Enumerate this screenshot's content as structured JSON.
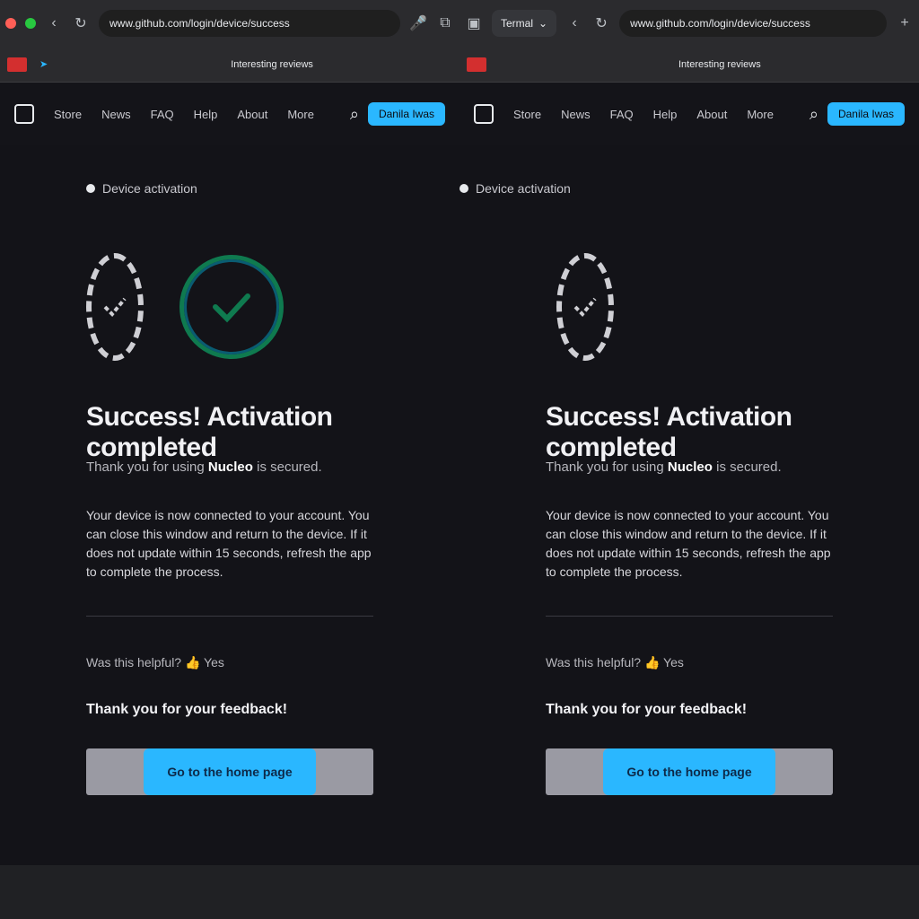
{
  "browser": {
    "tab_title": "Termal",
    "url": "www.github.com/login/device/success",
    "bookmark_label": "Interesting reviews"
  },
  "site": {
    "nav": [
      "Store",
      "News",
      "FAQ",
      "Help",
      "About",
      "More"
    ],
    "user_button": "Danila Iwas"
  },
  "page": {
    "breadcrumb": "Device activation",
    "title": "Success! Activation completed",
    "subtitle_prefix": "Thank you for using ",
    "subtitle_bold": "Nucleo",
    "subtitle_suffix": " is secured.",
    "body": "Your device is now connected to your account. You can close this window and return to the device. If it does not update within 15 seconds, refresh the app to complete the process.",
    "helpful_label": "Was this helpful? 👍 Yes",
    "feedback_thanks": "Thank you for your feedback!",
    "home_button": "Go to the home page"
  },
  "colors": {
    "accent": "#2ab7ff",
    "success_ring": "#0f7a4f",
    "background": "#131318"
  }
}
